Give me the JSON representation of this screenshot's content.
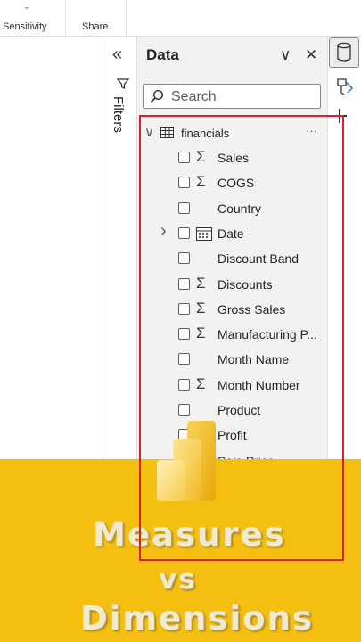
{
  "ribbon": {
    "items": [
      {
        "label": "Sensitivity",
        "chevron": "⌄"
      },
      {
        "label": "Share"
      }
    ]
  },
  "filters_pane": {
    "title": "Filters",
    "collapse_glyph": "«"
  },
  "data_pane": {
    "title": "Data",
    "collapse_glyph": "∨",
    "close_glyph": "✕",
    "search_placeholder": "Search",
    "table": {
      "name": "financials",
      "more_glyph": "···",
      "fields": [
        {
          "name": "Sales",
          "icon": "sigma-icon",
          "glyph": "Σ"
        },
        {
          "name": "COGS",
          "icon": "sigma-icon",
          "glyph": "Σ"
        },
        {
          "name": "Country",
          "icon": "",
          "glyph": ""
        },
        {
          "name": "Date",
          "icon": "calendar-icon",
          "glyph": "",
          "expandable": true
        },
        {
          "name": "Discount Band",
          "icon": "",
          "glyph": ""
        },
        {
          "name": "Discounts",
          "icon": "sigma-icon",
          "glyph": "Σ"
        },
        {
          "name": "Gross Sales",
          "icon": "sigma-icon",
          "glyph": "Σ"
        },
        {
          "name": "Manufacturing P...",
          "icon": "sigma-icon",
          "glyph": "Σ"
        },
        {
          "name": "Month Name",
          "icon": "",
          "glyph": ""
        },
        {
          "name": "Month Number",
          "icon": "sigma-icon",
          "glyph": "Σ"
        },
        {
          "name": "Product",
          "icon": "",
          "glyph": ""
        },
        {
          "name": "Profit",
          "icon": "sigma-icon",
          "glyph": "Σ"
        },
        {
          "name": "Sale Price",
          "icon": "sigma-icon",
          "glyph": "Σ"
        }
      ]
    }
  },
  "banner": {
    "line1": "Measures",
    "line2": "vs",
    "line3": "Dimensions",
    "color": "#f5bf12",
    "logo": "power-bi-logo-icon"
  },
  "highlight_color": "#e01d2b"
}
